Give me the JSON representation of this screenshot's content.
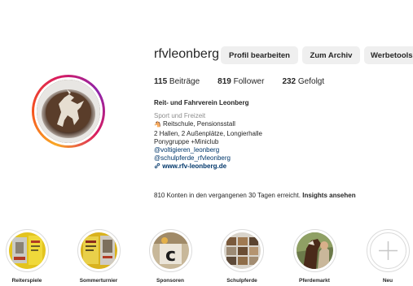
{
  "profile": {
    "username": "rfvleonberg",
    "buttons": {
      "edit": "Profil bearbeiten",
      "archive": "Zum Archiv",
      "ads": "Werbetools"
    },
    "stats": {
      "posts_count": "115",
      "posts_label": "Beiträge",
      "followers_count": "819",
      "followers_label": "Follower",
      "following_count": "232",
      "following_label": "Gefolgt"
    },
    "bio": {
      "full_name": "Reit- und Fahrverein Leonberg",
      "category": "Sport und Freizeit",
      "line1": "Reitschule, Pensionsstall",
      "line2": "2 Hallen, 2 Außenplätze, Longierhalle",
      "line3": "Ponygruppe +Miniclub",
      "mention1": "@voltigieren_leonberg",
      "mention2": "@schulpferde_rfvleonberg",
      "website": "www.rfv-leonberg.de"
    },
    "insights": {
      "text": "810 Konten in den vergangenen 30 Tagen erreicht.",
      "link": "Insights ansehen"
    }
  },
  "highlights": [
    {
      "label": "Reiterspiele"
    },
    {
      "label": "Sommerturnier"
    },
    {
      "label": "Sponsoren"
    },
    {
      "label": "Schulpferde"
    },
    {
      "label": "Pferdemarkt"
    },
    {
      "label": "Neu"
    }
  ],
  "icons": {
    "horse": "horse-emoji-icon",
    "link": "link-icon",
    "plus": "plus-icon"
  },
  "colors": {
    "link": "#00376b",
    "button_bg": "#efefef",
    "muted": "#8e8e8e"
  }
}
